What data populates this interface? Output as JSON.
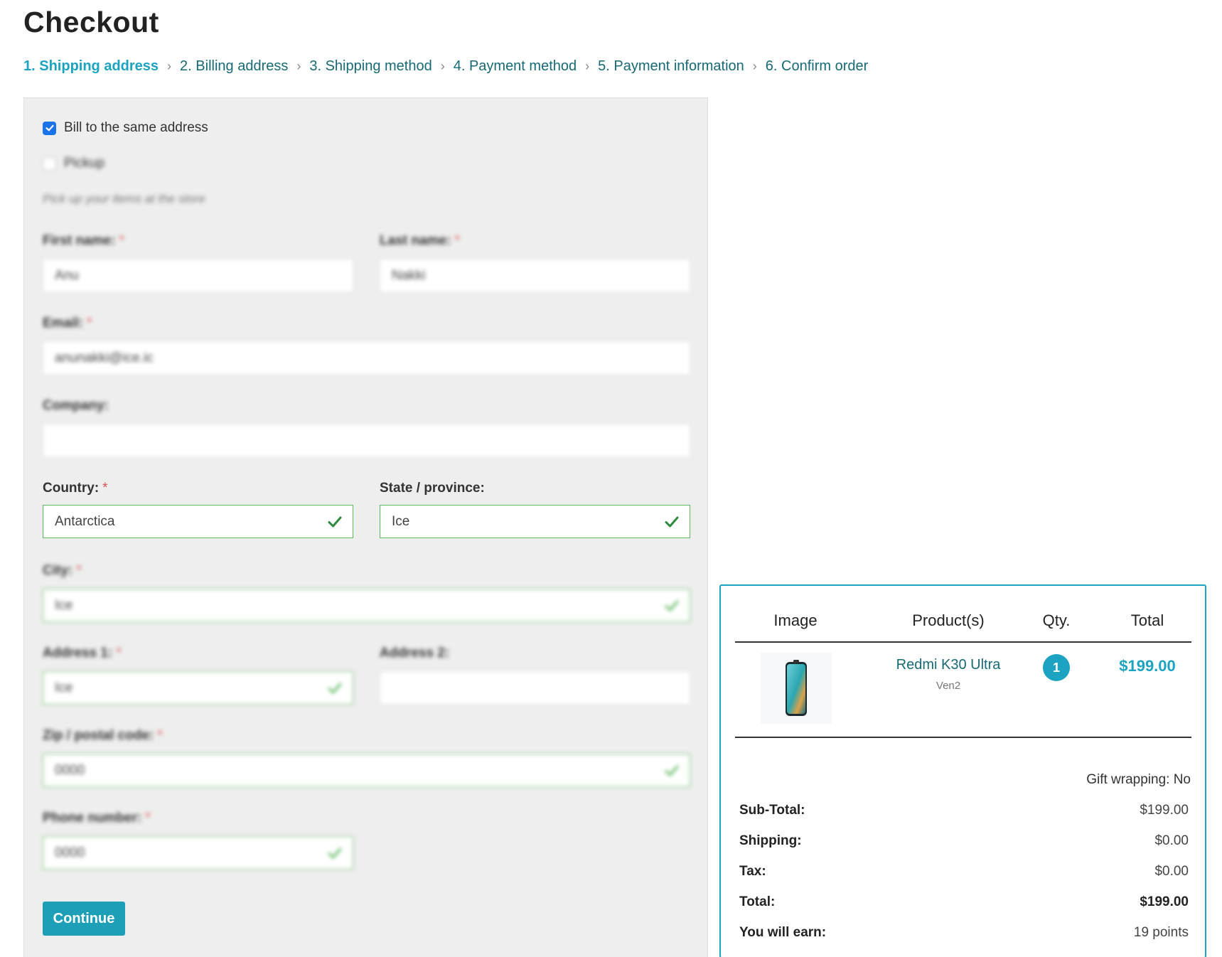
{
  "page": {
    "title": "Checkout"
  },
  "steps": [
    {
      "label": "1. Shipping address",
      "active": true
    },
    {
      "label": "2. Billing address",
      "active": false
    },
    {
      "label": "3. Shipping method",
      "active": false
    },
    {
      "label": "4. Payment method",
      "active": false
    },
    {
      "label": "5. Payment information",
      "active": false
    },
    {
      "label": "6. Confirm order",
      "active": false
    }
  ],
  "form": {
    "bill_same": {
      "label": "Bill to the same address",
      "checked": true
    },
    "pickup": {
      "label": "Pickup",
      "checked": false
    },
    "pickup_hint": "Pick up your items at the store",
    "required_mark": "*",
    "first_name": {
      "label": "First name:",
      "value": "Anu"
    },
    "last_name": {
      "label": "Last name:",
      "value": "Nakki"
    },
    "email": {
      "label": "Email:",
      "value": "anunakki@ice.ic"
    },
    "company": {
      "label": "Company:",
      "value": ""
    },
    "country": {
      "label": "Country:",
      "value": "Antarctica"
    },
    "state": {
      "label": "State / province:",
      "value": "Ice"
    },
    "city": {
      "label": "City:",
      "value": "Ice"
    },
    "address1": {
      "label": "Address 1:",
      "value": "Ice"
    },
    "address2": {
      "label": "Address 2:",
      "value": ""
    },
    "zip": {
      "label": "Zip / postal code:",
      "value": "0000"
    },
    "phone": {
      "label": "Phone number:",
      "value": "0000"
    },
    "continue_label": "Continue"
  },
  "summary": {
    "headers": {
      "image": "Image",
      "product": "Product(s)",
      "qty": "Qty.",
      "total": "Total"
    },
    "item": {
      "name": "Redmi K30 Ultra",
      "vendor": "Ven2",
      "qty": "1",
      "total": "$199.00",
      "image_icon": "phone-image"
    },
    "gift_wrapping": "Gift wrapping: No",
    "totals": [
      {
        "label": "Sub-Total:",
        "value": "$199.00"
      },
      {
        "label": "Shipping:",
        "value": "$0.00"
      },
      {
        "label": "Tax:",
        "value": "$0.00"
      },
      {
        "label": "Total:",
        "value": "$199.00"
      },
      {
        "label": "You will earn:",
        "value": "19 points"
      }
    ]
  },
  "colors": {
    "accent": "#1ba3c1",
    "link": "#166a75",
    "valid": "#5cb85c",
    "required": "#d9534f",
    "button": "#1e9fb8"
  }
}
